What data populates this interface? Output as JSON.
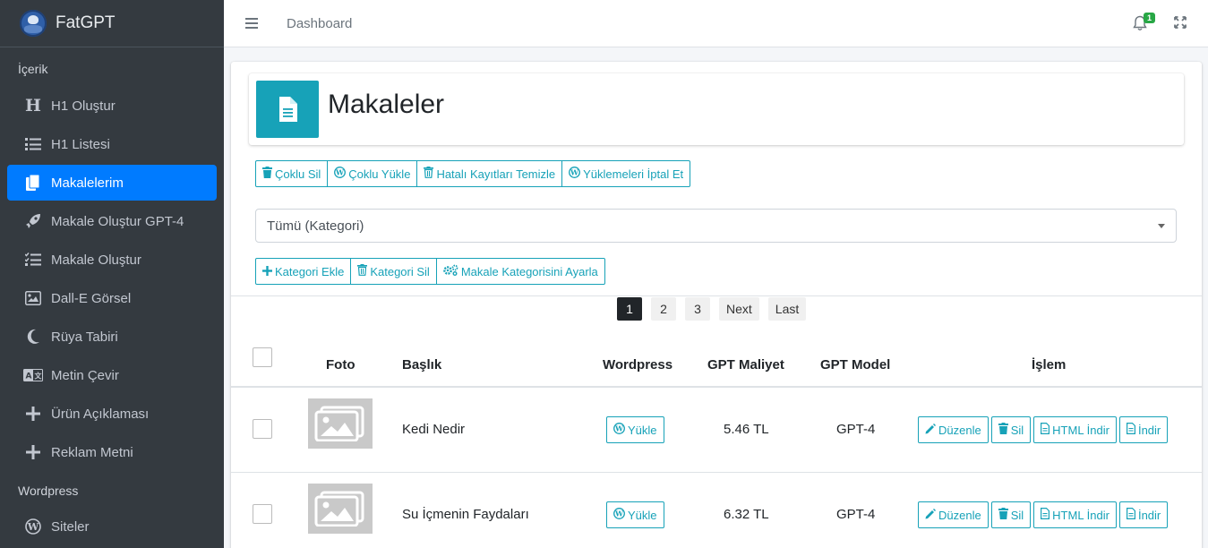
{
  "brand": {
    "name": "FatGPT"
  },
  "sidebar": {
    "section1": "İçerik",
    "items": [
      {
        "label": "H1 Oluştur",
        "icon": "heading-icon"
      },
      {
        "label": "H1 Listesi",
        "icon": "list-ol-icon"
      },
      {
        "label": "Makalelerim",
        "icon": "copy-icon",
        "active": true
      },
      {
        "label": "Makale Oluştur GPT-4",
        "icon": "rocket-icon"
      },
      {
        "label": "Makale Oluştur",
        "icon": "tasks-icon"
      },
      {
        "label": "Dall-E Görsel",
        "icon": "image-icon"
      },
      {
        "label": "Rüya Tabiri",
        "icon": "moon-icon"
      },
      {
        "label": "Metin Çevir",
        "icon": "language-icon"
      },
      {
        "label": "Ürün Açıklaması",
        "icon": "plus-icon"
      },
      {
        "label": "Reklam Metni",
        "icon": "plus-icon"
      }
    ],
    "section2": "Wordpress",
    "items2": [
      {
        "label": "Siteler",
        "icon": "wordpress-icon"
      }
    ]
  },
  "topbar": {
    "breadcrumb": "Dashboard",
    "notification_count": "1"
  },
  "page": {
    "title": "Makaleler"
  },
  "toolbar1": {
    "bulk_delete": "Çoklu Sil",
    "bulk_upload": "Çoklu Yükle",
    "clear_errors": "Hatalı Kayıtları Temizle",
    "cancel_uploads": "Yüklemeleri İptal Et"
  },
  "category_select": {
    "value": "Tümü (Kategori)"
  },
  "toolbar2": {
    "add_category": "Kategori Ekle",
    "delete_category": "Kategori Sil",
    "set_category": "Makale Kategorisini Ayarla"
  },
  "pagination": {
    "pages": [
      "1",
      "2",
      "3"
    ],
    "next": "Next",
    "last": "Last",
    "current": "1"
  },
  "table": {
    "headers": {
      "photo": "Foto",
      "title": "Başlık",
      "wordpress": "Wordpress",
      "cost": "GPT Maliyet",
      "model": "GPT Model",
      "action": "İşlem"
    },
    "upload_label": "Yükle",
    "edit_label": "Düzenle",
    "delete_label": "Sil",
    "html_download_label": "HTML İndir",
    "download_label": "İndir",
    "rows": [
      {
        "title": "Kedi Nedir",
        "cost": "5.46 TL",
        "model": "GPT-4"
      },
      {
        "title": "Su İçmenin Faydaları",
        "cost": "6.32 TL",
        "model": "GPT-4"
      }
    ]
  },
  "colors": {
    "sidebar_bg": "#343a40",
    "active": "#007bff",
    "accent": "#17a2b8",
    "badge": "#28a745"
  }
}
